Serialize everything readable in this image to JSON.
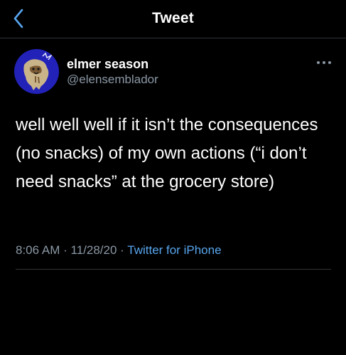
{
  "header": {
    "title": "Tweet",
    "back_icon": "chevron-left-icon"
  },
  "tweet": {
    "author_name": "elmer season",
    "author_handle": "@elensemblador",
    "text": "well well well if it isn’t the consequences (no snacks) of my own actions (“i don’t need snacks” at the grocery store)",
    "time": "8:06 AM",
    "separator": "·",
    "date": "11/28/20",
    "source": "Twitter for iPhone"
  },
  "colors": {
    "background": "#000000",
    "accent": "#58a6ef",
    "secondary_text": "#8b98a5",
    "divider": "#2f3336"
  }
}
